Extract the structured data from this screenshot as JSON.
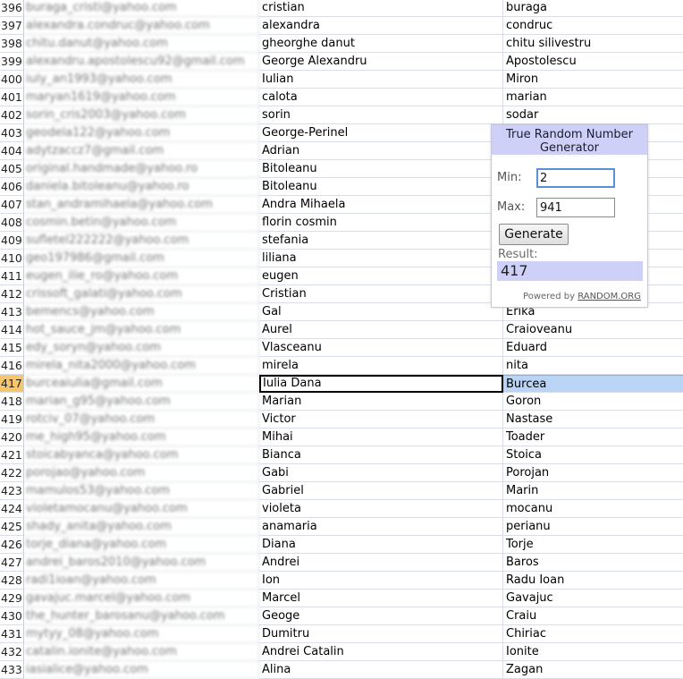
{
  "rows": [
    {
      "num": "396",
      "email": "buraga_cristi@yahoo.com",
      "first": "cristian",
      "last": "buraga"
    },
    {
      "num": "397",
      "email": "alexandra.condruc@yahoo.com",
      "first": "alexandra",
      "last": "condruc"
    },
    {
      "num": "398",
      "email": "chitu.danut@yahoo.com",
      "first": "gheorghe danut",
      "last": "chitu silivestru"
    },
    {
      "num": "399",
      "email": "alexandru.apostolescu92@gmail.com",
      "first": "George Alexandru",
      "last": "Apostolescu"
    },
    {
      "num": "400",
      "email": "iuly_an1993@yahoo.com",
      "first": "Iulian",
      "last": "Miron"
    },
    {
      "num": "401",
      "email": "maryan1619@yahoo.com",
      "first": "calota",
      "last": "marian"
    },
    {
      "num": "402",
      "email": "sorin_cris2003@yahoo.com",
      "first": "sorin",
      "last": "sodar"
    },
    {
      "num": "403",
      "email": "geodela122@yahoo.com",
      "first": "George-Perinel",
      "last": ""
    },
    {
      "num": "404",
      "email": "adytzaccz7@gmail.com",
      "first": "Adrian",
      "last": ""
    },
    {
      "num": "405",
      "email": "original.handmade@yahoo.ro",
      "first": "Bitoleanu",
      "last": ""
    },
    {
      "num": "406",
      "email": "daniela.bitoleanu@yahoo.ro",
      "first": "Bitoleanu",
      "last": ""
    },
    {
      "num": "407",
      "email": "stan_andramihaela@yahoo.com",
      "first": "Andra Mihaela",
      "last": ""
    },
    {
      "num": "408",
      "email": "cosmin.betin@yahoo.com",
      "first": "florin cosmin",
      "last": ""
    },
    {
      "num": "409",
      "email": "sufletel222222@yahoo.com",
      "first": "stefania",
      "last": ""
    },
    {
      "num": "410",
      "email": "geo197986@gmail.com",
      "first": "liliana",
      "last": ""
    },
    {
      "num": "411",
      "email": "eugen_ilie_ro@yahoo.com",
      "first": "eugen",
      "last": ""
    },
    {
      "num": "412",
      "email": "crissoft_galati@yahoo.com",
      "first": "Cristian",
      "last": ""
    },
    {
      "num": "413",
      "email": "bemencs@yahoo.com",
      "first": "Gal",
      "last": "Erika"
    },
    {
      "num": "414",
      "email": "hot_sauce_jm@yahoo.com",
      "first": "Aurel",
      "last": "Craioveanu"
    },
    {
      "num": "415",
      "email": "edy_soryn@yahoo.com",
      "first": "Vlasceanu",
      "last": "Eduard"
    },
    {
      "num": "416",
      "email": "mirela_nita2000@yahoo.com",
      "first": "mirela",
      "last": "nita"
    },
    {
      "num": "417",
      "email": "burceaiulia@gmail.com",
      "first": "Iulia Dana",
      "last": "Burcea"
    },
    {
      "num": "418",
      "email": "marian_g95@yahoo.com",
      "first": "Marian",
      "last": "Goron"
    },
    {
      "num": "419",
      "email": "rotciv_07@yahoo.com",
      "first": "Victor",
      "last": "Nastase"
    },
    {
      "num": "420",
      "email": "me_high95@yahoo.com",
      "first": "Mihai",
      "last": "Toader"
    },
    {
      "num": "421",
      "email": "stoicabyanca@yahoo.com",
      "first": "Bianca",
      "last": "Stoica"
    },
    {
      "num": "422",
      "email": "porojao@yahoo.com",
      "first": "Gabi",
      "last": "Porojan"
    },
    {
      "num": "423",
      "email": "mamulos53@yahoo.com",
      "first": "Gabriel",
      "last": "Marin"
    },
    {
      "num": "424",
      "email": "violetamocanu@yahoo.com",
      "first": "violeta",
      "last": "mocanu"
    },
    {
      "num": "425",
      "email": "shady_anita@yahoo.com",
      "first": "anamaria",
      "last": "perianu"
    },
    {
      "num": "426",
      "email": "torje_diana@yahoo.com",
      "first": "Diana",
      "last": "Torje"
    },
    {
      "num": "427",
      "email": "andrei_baros2010@yahoo.com",
      "first": "Andrei",
      "last": "Baros"
    },
    {
      "num": "428",
      "email": "radi1ioan@yahoo.com",
      "first": "Ion",
      "last": "Radu Ioan"
    },
    {
      "num": "429",
      "email": "gavajuc.marcel@yahoo.com",
      "first": "Marcel",
      "last": "Gavajuc"
    },
    {
      "num": "430",
      "email": "the_hunter_barosanu@yahoo.com",
      "first": "Geoge",
      "last": "Craiu"
    },
    {
      "num": "431",
      "email": "mytyy_08@yahoo.com",
      "first": "Dumitru",
      "last": "Chiriac"
    },
    {
      "num": "432",
      "email": "catalin.ionite@yahoo.com",
      "first": "Andrei Catalin",
      "last": "Ionite"
    },
    {
      "num": "433",
      "email": "iasialice@yahoo.com",
      "first": "Alina",
      "last": "Zagan"
    }
  ],
  "selected_row": "417",
  "widget": {
    "title": "True Random Number Generator",
    "min_label": "Min:",
    "min_value": "2",
    "max_label": "Max:",
    "max_value": "941",
    "button_label": "Generate",
    "result_label": "Result:",
    "result_value": "417",
    "powered_by": "Powered by",
    "powered_link": "RANDOM.ORG"
  },
  "colors": {
    "selected_row_header": "#f7c66b",
    "selected_cell_fill": "#b9d4f4",
    "widget_accent": "#cfd0f7"
  }
}
